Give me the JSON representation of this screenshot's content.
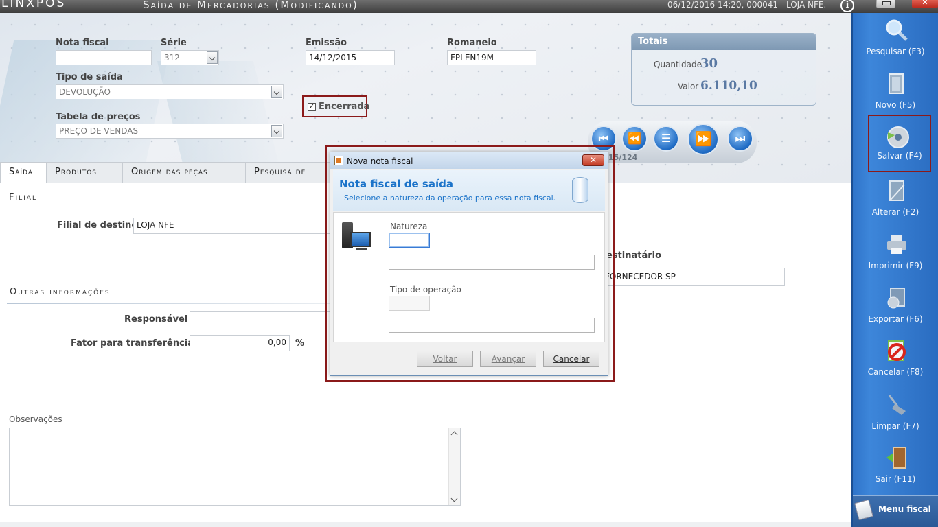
{
  "app": {
    "logo": "LINXPOS",
    "title": "Saída de Mercadorias (Modificando)",
    "status": "06/12/2016 14:20, 000041 - LOJA NFE."
  },
  "header": {
    "nota_fiscal_label": "Nota fiscal",
    "nota_fiscal_value": "",
    "serie_label": "Série",
    "serie_value": "312",
    "emissao_label": "Emissão",
    "emissao_value": "14/12/2015",
    "romaneio_label": "Romaneio",
    "romaneio_value": "FPLEN19M",
    "tipo_saida_label": "Tipo de saída",
    "tipo_saida_value": "DEVOLUÇÃO",
    "tabela_precos_label": "Tabela de preços",
    "tabela_precos_value": "PREÇO DE VENDAS",
    "encerrada_label": "Encerrada",
    "encerrada_checked": true
  },
  "totais": {
    "title": "Totais",
    "quantidade_label": "Quantidade",
    "quantidade_value": "30",
    "valor_label": "Valor",
    "valor_value": "6.110,10"
  },
  "navigator": {
    "counter": "15/124"
  },
  "tabs": [
    {
      "label": "Saída",
      "active": true
    },
    {
      "label": "Produtos",
      "active": false
    },
    {
      "label": "Origem das peças",
      "active": false
    },
    {
      "label": "Pesquisa de",
      "active": false
    }
  ],
  "main": {
    "filial_section": "Filial",
    "filial_destino_label": "Filial de destino",
    "filial_destino_value": "LOJA NFE",
    "destinatario_label": "estinatário",
    "destinatario_value": "FORNECEDOR SP",
    "outras_section": "Outras informações",
    "responsavel_label": "Responsável",
    "responsavel_value": "",
    "fator_label": "Fator para transferência",
    "fator_value": "0,00",
    "fator_unit": "%",
    "observacoes_label": "Observações"
  },
  "sidebar": [
    {
      "label": "Pesquisar (F3)",
      "icon": "magnifier-icon"
    },
    {
      "label": "Novo (F5)",
      "icon": "new-document-icon"
    },
    {
      "label": "Salvar (F4)",
      "icon": "save-disc-icon"
    },
    {
      "label": "Alterar (F2)",
      "icon": "edit-document-icon"
    },
    {
      "label": "Imprimir (F9)",
      "icon": "printer-icon"
    },
    {
      "label": "Exportar (F6)",
      "icon": "export-icon"
    },
    {
      "label": "Cancelar (F8)",
      "icon": "cancel-icon"
    },
    {
      "label": "Limpar (F7)",
      "icon": "broom-icon"
    },
    {
      "label": "Sair (F11)",
      "icon": "exit-door-icon"
    }
  ],
  "menu_fiscal": "Menu fiscal",
  "dialog": {
    "window_title": "Nova nota fiscal",
    "heading": "Nota fiscal de saída",
    "subheading": "Selecione a natureza da operação para essa nota fiscal.",
    "natureza_label": "Natureza",
    "tipo_operacao_label": "Tipo de operação",
    "btn_voltar": "Voltar",
    "btn_avancar": "Avançar",
    "btn_cancelar": "Cancelar"
  },
  "colors": {
    "sidebar_blue": "#2f74c9",
    "highlight_red": "#8b1a1a",
    "dialog_heading_blue": "#1b73c9",
    "totais_value_blue": "#5a79a3"
  }
}
